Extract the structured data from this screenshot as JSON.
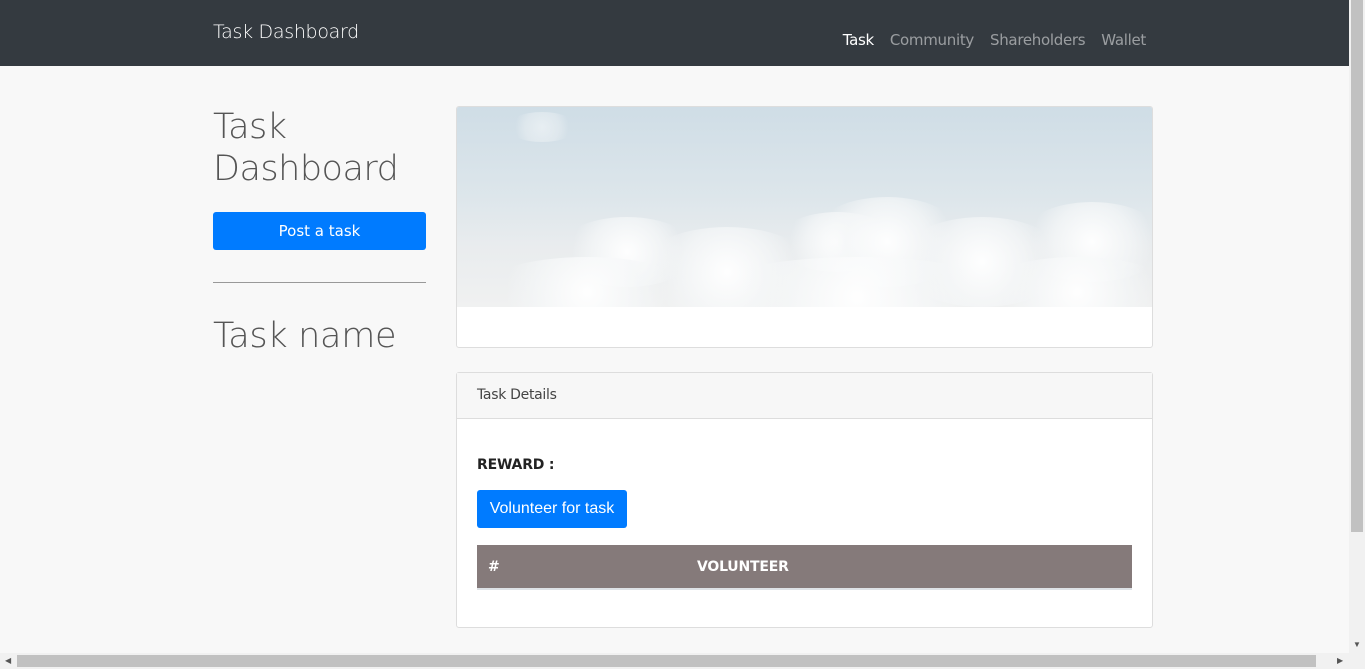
{
  "navbar": {
    "brand": "Task Dashboard",
    "links": [
      {
        "label": "Task",
        "active": true
      },
      {
        "label": "Community",
        "active": false
      },
      {
        "label": "Shareholders",
        "active": false
      },
      {
        "label": "Wallet",
        "active": false
      }
    ]
  },
  "sidebar": {
    "title_line1": "Task",
    "title_line2": "Dashboard",
    "post_button": "Post a task",
    "task_name": "Task name"
  },
  "details": {
    "header": "Task Details",
    "reward_label": "REWARD :",
    "volunteer_button": "Volunteer for task",
    "table_headers": [
      "#",
      "VOLUNTEER"
    ]
  },
  "colors": {
    "navbar_bg": "#343a40",
    "primary": "#007bff",
    "table_header_bg": "#857a7a"
  }
}
